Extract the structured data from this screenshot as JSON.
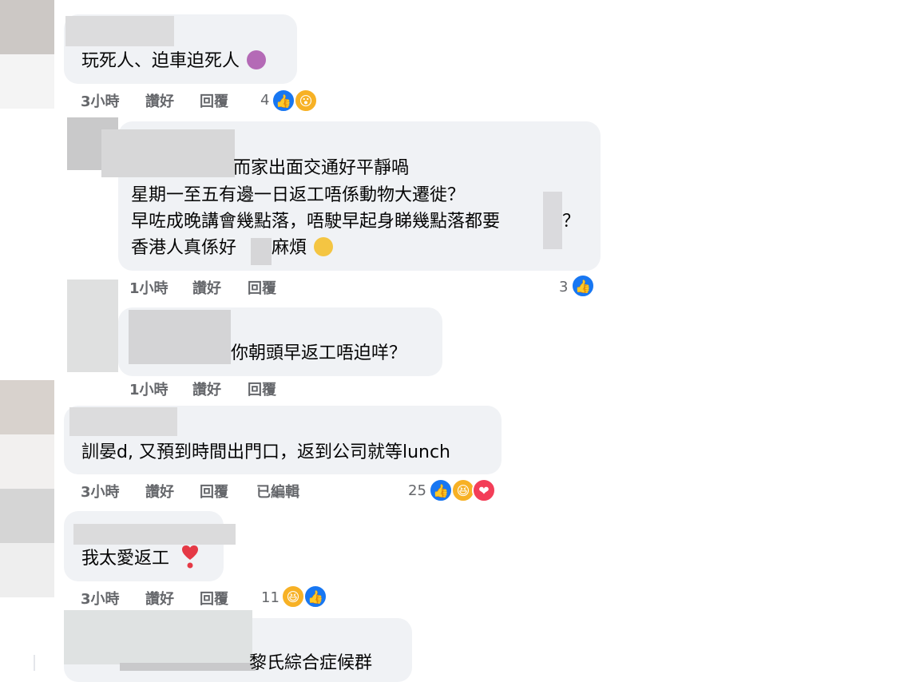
{
  "comments": [
    {
      "text": "玩死人、迫車迫死人",
      "time": "3小時",
      "like": "讚好",
      "reply": "回覆",
      "reaction_count": "4",
      "reactions": [
        "like-icon",
        "wow-icon"
      ]
    },
    {
      "lines": [
        "而家出面交通好平靜喎",
        "星期一至五有邊一日返工唔係動物大遷徙？",
        "早咗成晚講會幾點落，唔駛早起身睇幾點落都要",
        "香港人真係好",
        "麻煩"
      ],
      "end_mark": "？",
      "time": "1小時",
      "like": "讚好",
      "reply": "回覆",
      "reaction_count": "3",
      "reactions": [
        "like-icon"
      ]
    },
    {
      "text": "你朝頭早返工唔迫咩？",
      "time": "1小時",
      "like": "讚好",
      "reply": "回覆"
    },
    {
      "text": "訓晏d, 又預到時間出門口，返到公司就等lunch",
      "time": "3小時",
      "like": "讚好",
      "reply": "回覆",
      "edited": "已編輯",
      "reaction_count": "25",
      "reactions": [
        "like-icon",
        "haha-icon",
        "love-icon"
      ]
    },
    {
      "text": "我太愛返工",
      "time": "3小時",
      "like": "讚好",
      "reply": "回覆",
      "reaction_count": "11",
      "reactions": [
        "haha-icon",
        "like-icon"
      ]
    },
    {
      "text": "黎氏綜合症候群"
    }
  ]
}
